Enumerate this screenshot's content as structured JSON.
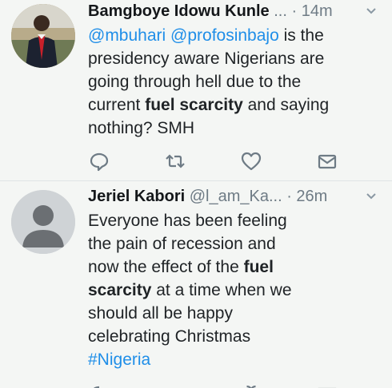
{
  "tweets": [
    {
      "name": "Bamgboye Idowu Kunle",
      "handle": "...",
      "time": "· 14m",
      "body": {
        "m1": "@mbuhari",
        "m2": "@profosinbajo",
        "t1": " is the presidency aware Nigerians are going through hell due to the current ",
        "b1": "fuel scarcity",
        "t2": " and saying nothing? SMH"
      }
    },
    {
      "name": "Jeriel Kabori",
      "handle": "@l_am_Ka...",
      "time": "· 26m",
      "body": {
        "t1": "Everyone has been feeling the pain of recession and now the effect of the ",
        "b1": "fuel scarcity",
        "t2": " at a time when we should all be happy celebrating Christmas",
        "hashtag": "#Nigeria"
      }
    }
  ],
  "icons": [
    "reply-icon",
    "retweet-icon",
    "like-icon",
    "message-icon",
    "chevron-down-icon"
  ],
  "colors": {
    "link": "#1f8ee8",
    "muted": "#6e7b85",
    "background": "#f4f6f4"
  }
}
